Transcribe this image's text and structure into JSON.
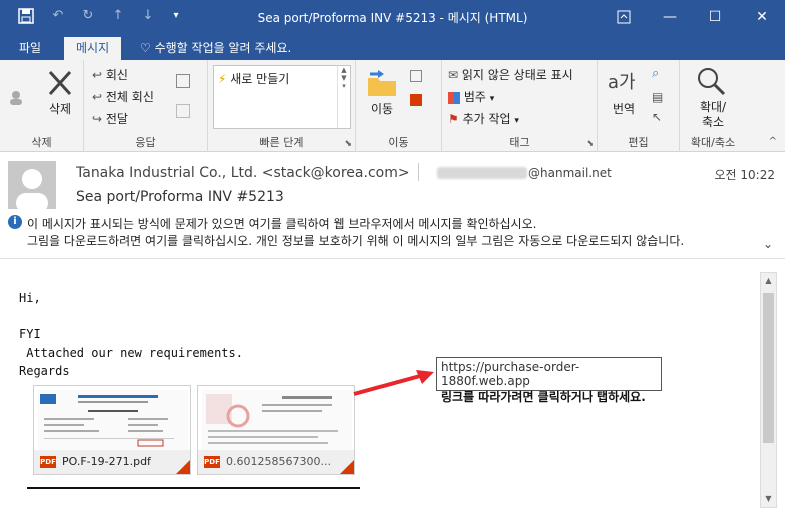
{
  "window": {
    "title": "Sea port/Proforma INV #5213 - 메시지 (HTML)"
  },
  "tabs": {
    "file": "파일",
    "message": "메시지",
    "tellme": "수행할 작업을 알려 주세요."
  },
  "ribbon": {
    "delete": {
      "label": "삭제",
      "group": "삭제"
    },
    "respond": {
      "reply": "회신",
      "reply_all": "전체 회신",
      "forward": "전달",
      "group": "응답"
    },
    "quick_steps": {
      "new": "새로 만들기",
      "group": "빠른 단계"
    },
    "move": {
      "label": "이동",
      "group": "이동"
    },
    "tags": {
      "mark_unread": "읽지 않은 상태로 표시",
      "categorize": "범주",
      "follow_up": "추가 작업",
      "group": "태그"
    },
    "editing": {
      "translate": "번역",
      "group": "편집"
    },
    "zoom": {
      "label": "확대/축소",
      "label_line1": "확대/",
      "label_line2": "축소",
      "group": "확대/축소"
    }
  },
  "message": {
    "sender": "Tanaka Industrial Co., Ltd. <stack@korea.com>",
    "to_domain": "@hanmail.net",
    "time": "오전 10:22",
    "subject": "Sea port/Proforma INV #5213",
    "info_line1": "이 메시지가 표시되는 방식에 문제가 있으면 여기를 클릭하여 웹 브라우저에서 메시지를 확인하십시오.",
    "info_line2": "그림을 다운로드하려면 여기를 클릭하십시오. 개인 정보를 보호하기 위해 이 메시지의 일부 그림은 자동으로 다운로드되지 않습니다."
  },
  "body": {
    "greeting": "Hi,",
    "line_fyi": "FYI",
    "line_attached": " Attached our new requirements.",
    "line_regards": "Regards"
  },
  "attachments": [
    {
      "name": "PO.F-19-271.pdf",
      "badge": "PDF"
    },
    {
      "name": "0.601258567300...",
      "badge": "PDF"
    }
  ],
  "tooltip": {
    "url": "https://purchase-order-1880f.web.app",
    "hint": "링크를 따라가려면 클릭하거나 탭하세요."
  },
  "colors": {
    "brand": "#2b579a",
    "pdf": "#d83b01",
    "arrow": "#e8262b"
  }
}
